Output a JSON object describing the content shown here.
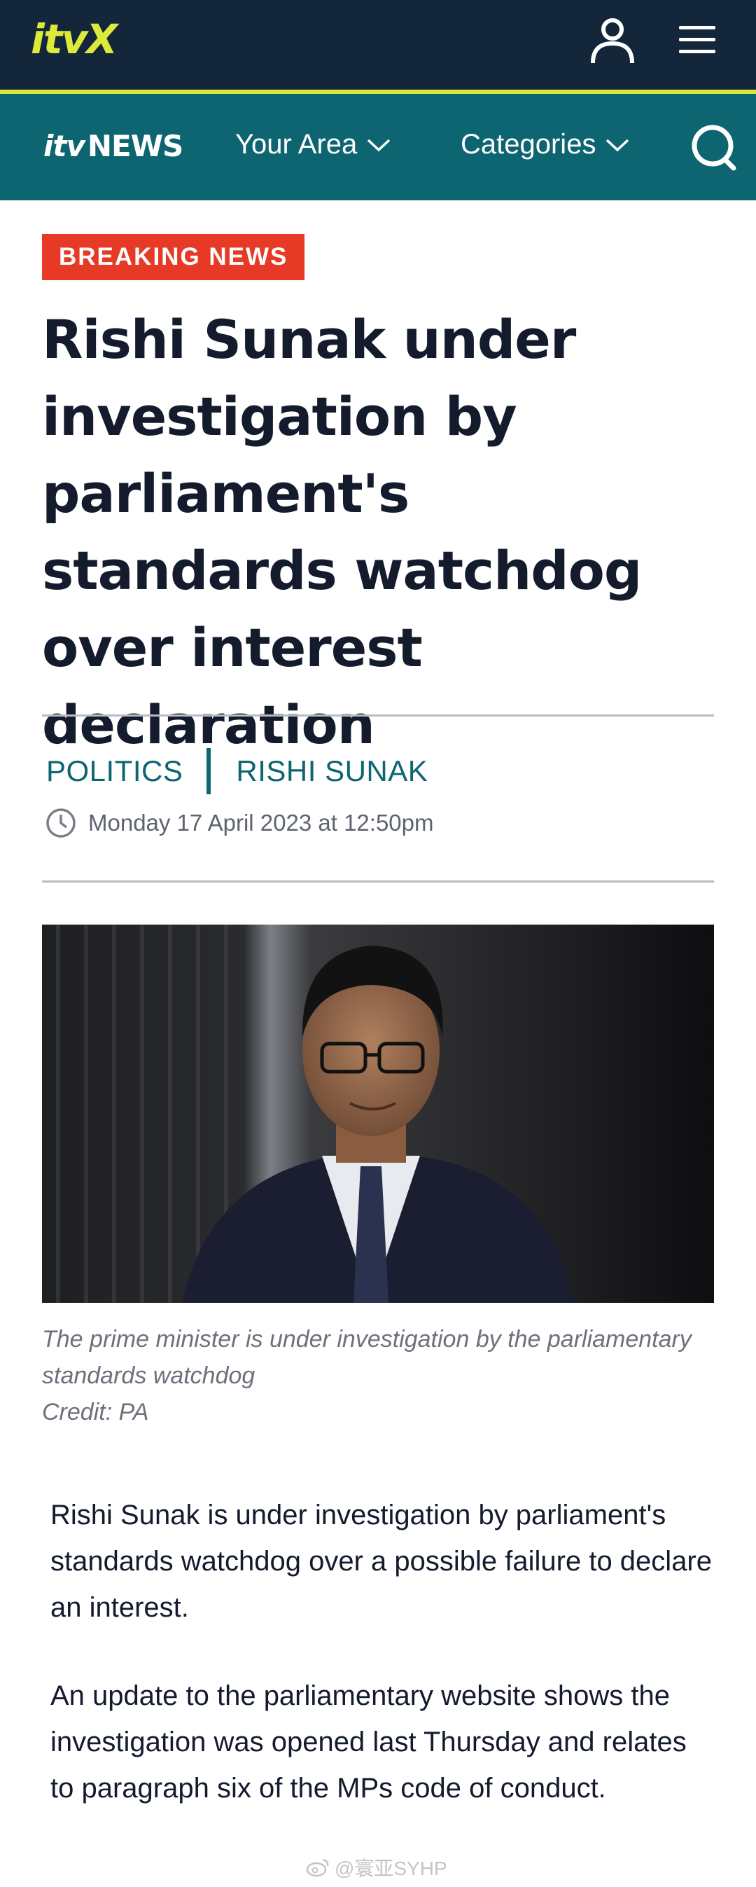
{
  "topbar": {
    "logo": "itvX",
    "icons": [
      "account-icon",
      "menu-icon"
    ]
  },
  "newsbar": {
    "logo_itv": "itv",
    "logo_news": "NEWS",
    "nav": [
      {
        "label": "Your Area"
      },
      {
        "label": "Categories"
      }
    ],
    "search_icon": "search-icon"
  },
  "article": {
    "badge": "BREAKING NEWS",
    "headline": "Rishi Sunak under investigation by parliament's standards watchdog over interest declaration",
    "tags": [
      "POLITICS",
      "RISHI SUNAK"
    ],
    "date": "Monday 17 April 2023 at 12:50pm",
    "image_caption": "The prime minister is under investigation by the parliamentary standards watchdog",
    "image_credit": "Credit: PA",
    "paragraphs": [
      "Rishi Sunak is under investigation by parliament's standards watchdog over a possible failure to declare an interest.",
      "An update to the parliamentary website shows the investigation was opened last Thursday and relates to paragraph six of the MPs code of conduct."
    ]
  },
  "watermark": "@寰亚SYHP",
  "colors": {
    "topbar_bg": "#14263a",
    "accent_lime": "#d8e83a",
    "news_teal": "#0d6572",
    "breaking_red": "#e63a27"
  }
}
